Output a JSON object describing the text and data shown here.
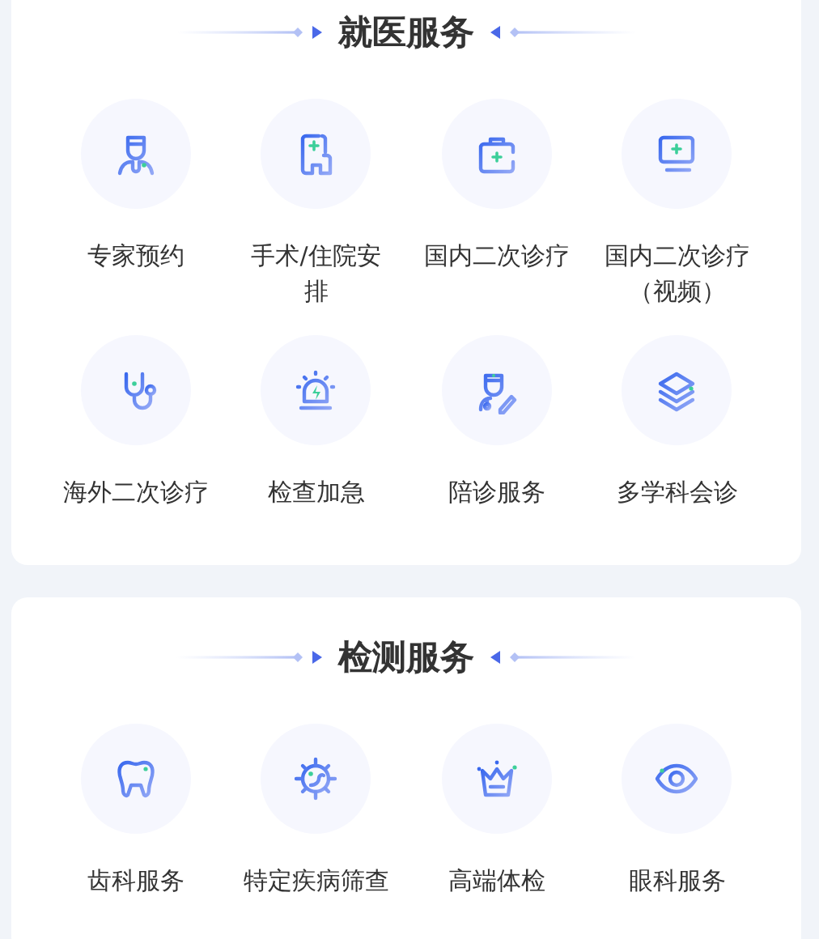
{
  "sections": [
    {
      "title": "就医服务",
      "items": [
        {
          "label": "专家预约"
        },
        {
          "label": "手术/住院安排"
        },
        {
          "label": "国内二次诊疗"
        },
        {
          "label": "国内二次诊疗（视频）"
        },
        {
          "label": "海外二次诊疗"
        },
        {
          "label": "检查加急"
        },
        {
          "label": "陪诊服务"
        },
        {
          "label": "多学科会诊"
        }
      ]
    },
    {
      "title": "检测服务",
      "items": [
        {
          "label": "齿科服务"
        },
        {
          "label": "特定疾病筛查"
        },
        {
          "label": "高端体检"
        },
        {
          "label": "眼科服务"
        }
      ]
    }
  ]
}
